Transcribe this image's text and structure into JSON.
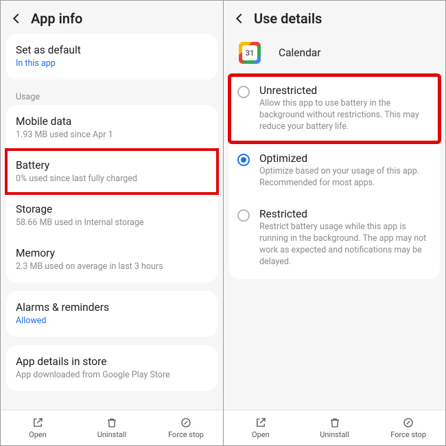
{
  "left": {
    "title": "App info",
    "default": {
      "title": "Set as default",
      "sub": "In this app"
    },
    "usage_label": "Usage",
    "mobile_data": {
      "title": "Mobile data",
      "sub": "1.93 MB used since Apr 1"
    },
    "battery": {
      "title": "Battery",
      "sub": "0% used since last fully charged"
    },
    "storage": {
      "title": "Storage",
      "sub": "58.66 MB used in Internal storage"
    },
    "memory": {
      "title": "Memory",
      "sub": "2.3 MB used on average in last 3 hours"
    },
    "alarms": {
      "title": "Alarms & reminders",
      "sub": "Allowed"
    },
    "details": {
      "title": "App details in store",
      "sub": "App downloaded from Google Play Store"
    },
    "bottom": {
      "open": "Open",
      "uninstall": "Uninstall",
      "force": "Force stop"
    }
  },
  "right": {
    "title": "Use details",
    "app_name": "Calendar",
    "unrestricted": {
      "title": "Unrestricted",
      "desc": "Allow this app to use battery in the background without restrictions. This may reduce your battery life."
    },
    "optimized": {
      "title": "Optimized",
      "desc": "Optimize based on your usage of this app. Recommended for most apps."
    },
    "restricted": {
      "title": "Restricted",
      "desc": "Restrict battery usage while this app is running in the background. The app may not work as expected and notifications may be delayed."
    },
    "bottom": {
      "open": "Open",
      "uninstall": "Uninstall",
      "force": "Force stop"
    }
  }
}
